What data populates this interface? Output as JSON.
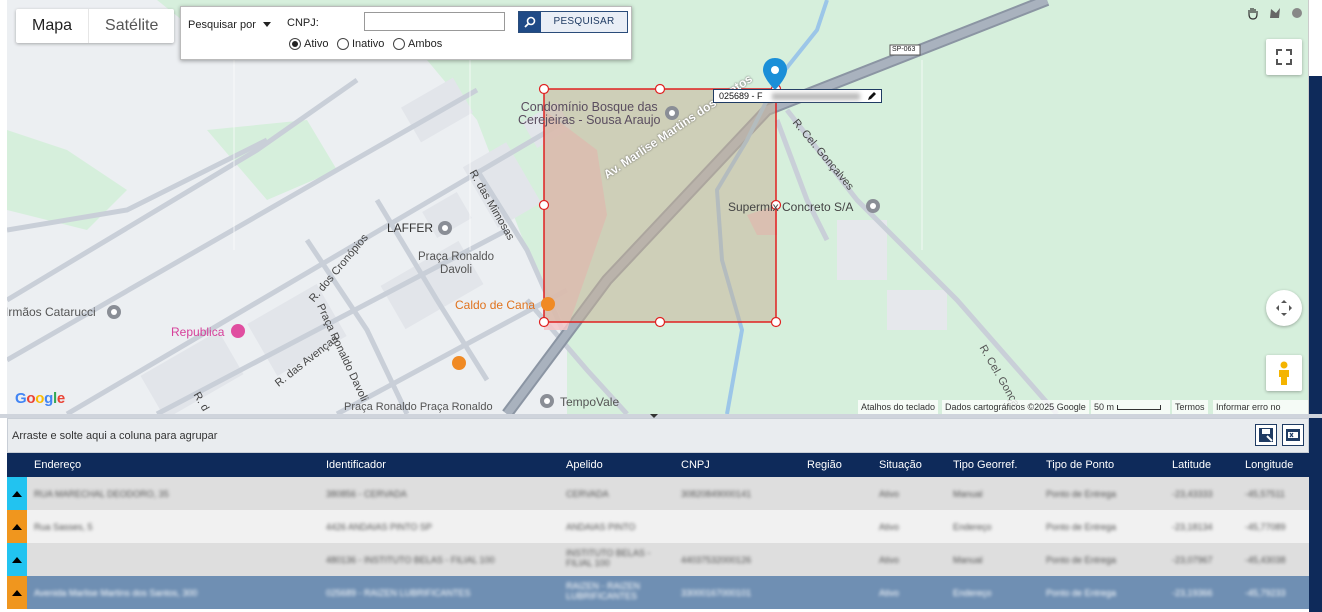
{
  "map": {
    "type_buttons": {
      "map": "Mapa",
      "satellite": "Satélite"
    },
    "search": {
      "search_by_label": "Pesquisar por",
      "cnpj_label": "CNPJ:",
      "cnpj_value": "",
      "button_label": "PESQUISAR",
      "status_options": [
        {
          "label": "Ativo",
          "selected": true
        },
        {
          "label": "Inativo",
          "selected": false
        },
        {
          "label": "Ambos",
          "selected": false
        }
      ]
    },
    "places": {
      "condominio_line1": "Condomínio Bosque das",
      "condominio_line2": "Cerejeiras - Sousa Araujo",
      "avenue": "Av. Marlise Martins dos Santos",
      "mimosas": "R. das Mimosas",
      "laffer": "LAFFER",
      "praca_ronaldo_line1": "Praça Ronaldo",
      "praca_ronaldo_line2": "Davoli",
      "caldo": "Caldo de Cana",
      "supermix": "Supermix Concreto S/A",
      "cel_goncalves": "R. Cel. Gonçalves",
      "cel_goncalves_2": "R. Cel. Gonça",
      "cronopios": "R. dos Cronópios",
      "irmaos": "Irmãos Catarucci",
      "republica": "Republica",
      "praca_ronaldo_davoli": "Praça Ronaldo Davoli",
      "avencas": "R. das Avenças",
      "praca_ronaldo_bottom": "Praça Ronaldo  Praça Ronaldo",
      "tempovale": "TempoVale",
      "r_d": "R. d",
      "sp_shield": "SP-063"
    },
    "shape_label_prefix": "025689 - F",
    "attribution": {
      "google": "Google",
      "shortcuts": "Atalhos do teclado",
      "data": "Dados cartográficos ©2025 Google",
      "scale": "50 m",
      "terms": "Termos",
      "report": "Informar erro no mapa"
    }
  },
  "grid": {
    "group_hint": "Arraste e solte aqui a coluna para agrupar",
    "columns": [
      "Endereço",
      "Identificador",
      "Apelido",
      "CNPJ",
      "Região",
      "Situação",
      "Tipo Georref.",
      "Tipo de Ponto",
      "Latitude",
      "Longitude"
    ],
    "rows": [
      {
        "expander_color": "#22c3f0",
        "background": "#dedede",
        "selected": false,
        "cells": [
          "RUA MARECHAL DEODORO, 35",
          "380856 - CERVADA",
          "CERVADA",
          "30820849000141",
          "",
          "Ativo",
          "Manual",
          "Ponto de Entrega",
          "-23,43333",
          "-45,57511"
        ]
      },
      {
        "expander_color": "#f0961e",
        "background": "#f1f1f1",
        "selected": false,
        "cells": [
          "Rua Sasses, 5",
          "4426 ANDAIAS PINTO SP",
          "ANDAIAS PINTO",
          "",
          "",
          "Ativo",
          "Endereço",
          "Ponto de Entrega",
          "-23,18134",
          "-45,77089"
        ]
      },
      {
        "expander_color": "#22c3f0",
        "background": "#dedede",
        "selected": false,
        "cells": [
          "",
          "480136 - INSTITUTO BELAS - FILIAL 100",
          "INSTITUTO BELAS - FILIAL 100",
          "44037532000126",
          "",
          "Ativo",
          "Manual",
          "Ponto de Entrega",
          "-23,07967",
          "-45,43038"
        ]
      },
      {
        "expander_color": "#f0961e",
        "background": "#6f8fb3",
        "selected": true,
        "cells": [
          "Avenida Marlise Martins dos Santos, 300",
          "025689 - RAIZEN LUBRIFICANTES",
          "RAIZEN - RAIZEN LUBRIFICANTES",
          "33000167000101",
          "",
          "Ativo",
          "Endereço",
          "Ponto de Entrega",
          "-23,19366",
          "-45,79233"
        ]
      }
    ]
  }
}
